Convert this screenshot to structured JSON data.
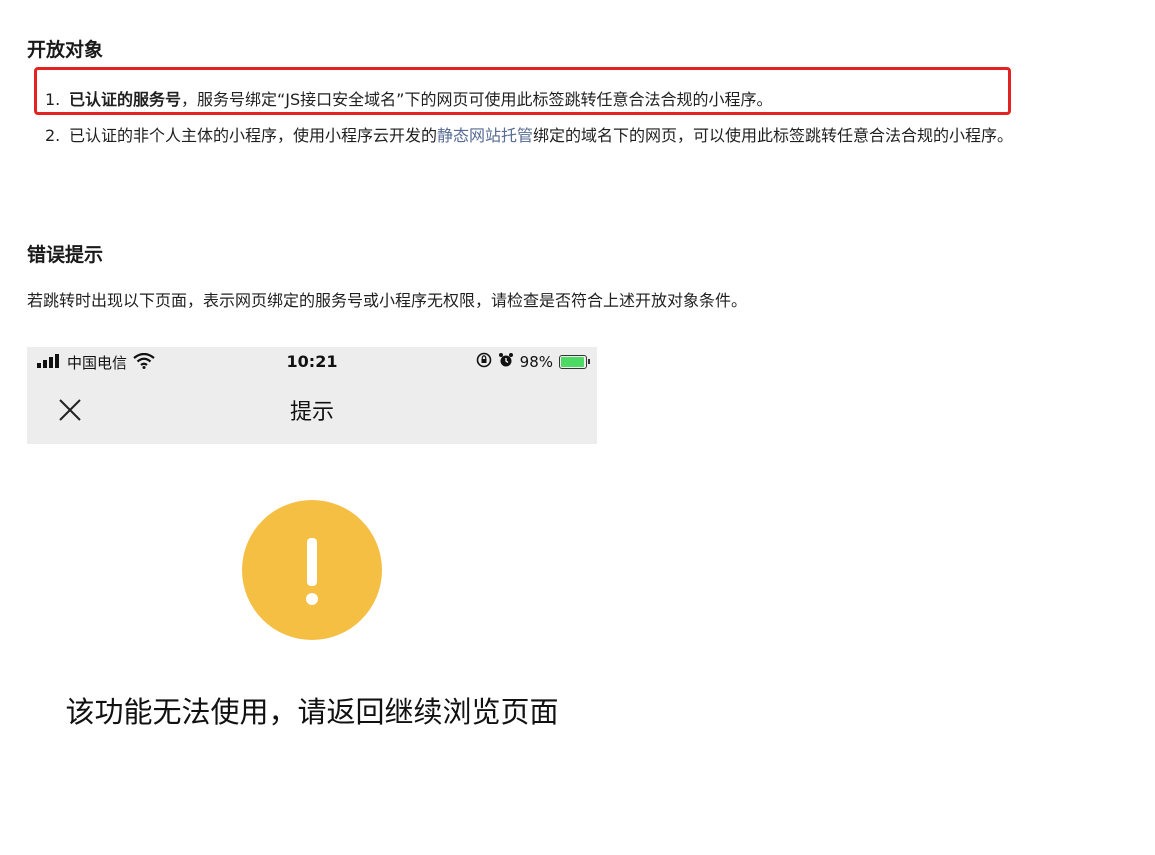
{
  "section_open": {
    "title": "开放对象",
    "items": [
      {
        "number": "1.",
        "bold_text": "已认证的服务号",
        "text": "，服务号绑定“JS接口安全域名”下的网页可使用此标签跳转任意合法合规的小程序。"
      },
      {
        "number": "2.",
        "text_before": "已认证的非个人主体的小程序，使用小程序云开发的",
        "link_text": "静态网站托管",
        "text_after": "绑定的域名下的网页，可以使用此标签跳转任意合法合规的小程序。"
      }
    ]
  },
  "section_error": {
    "title": "错误提示",
    "description": "若跳转时出现以下页面，表示网页绑定的服务号或小程序无权限，请检查是否符合上述开放对象条件。"
  },
  "phone": {
    "carrier": "中国电信",
    "time": "10:21",
    "battery_percent": "98%",
    "battery_level": 0.98,
    "nav_title": "提示",
    "message": "该功能无法使用，请返回继续浏览页面",
    "warning_color": "#f4bf42",
    "icons": [
      "signal-icon",
      "wifi-icon",
      "orientation-lock-icon",
      "alarm-icon",
      "battery-icon",
      "close-icon",
      "warning-icon"
    ]
  },
  "colors": {
    "link": "#576b95",
    "highlight": "#e52222"
  }
}
